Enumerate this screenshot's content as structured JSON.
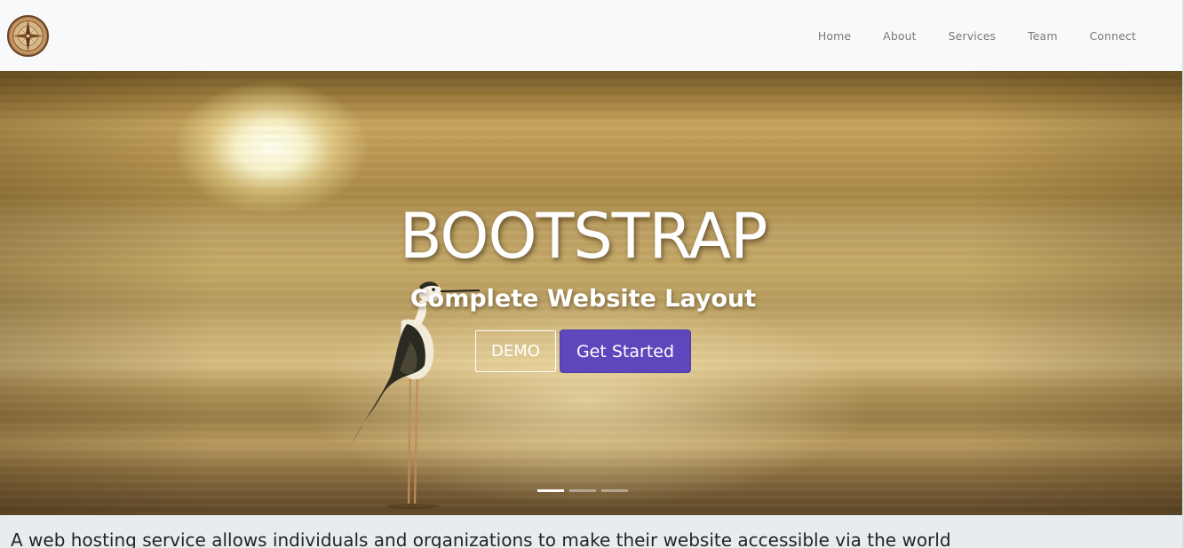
{
  "navbar": {
    "logo_icon": "compass-rose-icon",
    "links": [
      "Home",
      "About",
      "Services",
      "Team",
      "Connect"
    ]
  },
  "hero": {
    "title": "BOOTSTRAP",
    "subtitle": "Complete Website Layout",
    "demo_button": "DEMO",
    "start_button": "Get Started",
    "slide_count": 3,
    "active_slide": 1
  },
  "content": {
    "intro": "A web hosting service allows individuals and organizations to make their website accessible via the world"
  },
  "colors": {
    "navbar_bg": "#f8f9fa",
    "accent_button": "#5f46bd",
    "nav_link": "#7a7a7a",
    "content_bg": "#e9ecef"
  }
}
